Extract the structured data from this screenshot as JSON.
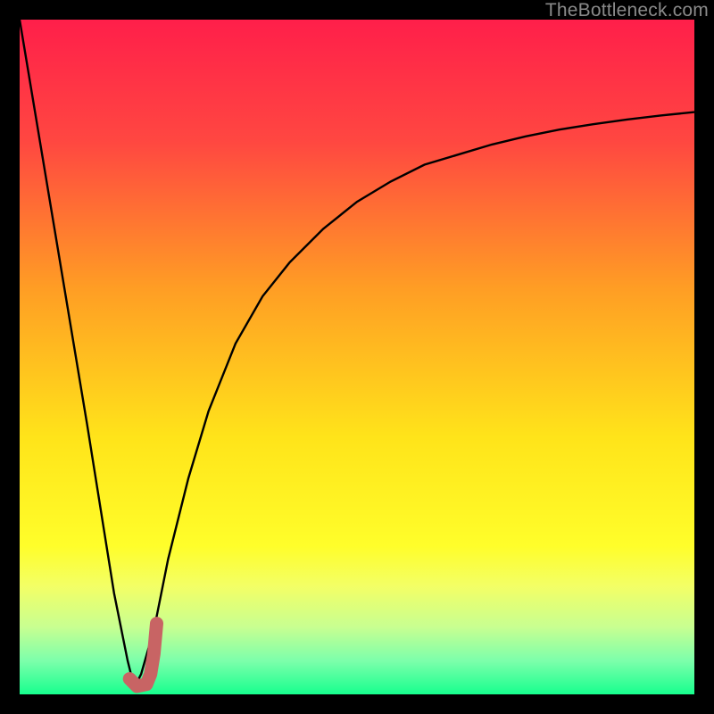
{
  "watermark": "TheBottleneck.com",
  "gradient_stops": [
    {
      "pct": 0,
      "color": "#ff1f4a"
    },
    {
      "pct": 18,
      "color": "#ff4741"
    },
    {
      "pct": 40,
      "color": "#ff9e24"
    },
    {
      "pct": 62,
      "color": "#ffe41a"
    },
    {
      "pct": 78,
      "color": "#fffe2a"
    },
    {
      "pct": 84,
      "color": "#f3ff66"
    },
    {
      "pct": 90,
      "color": "#c8ff91"
    },
    {
      "pct": 95,
      "color": "#7dffab"
    },
    {
      "pct": 100,
      "color": "#17ff8e"
    }
  ],
  "curve": {
    "color": "#000000",
    "width": 2.4
  },
  "marker": {
    "color": "#c86464",
    "width": 15,
    "linecap": "round"
  },
  "chart_data": {
    "type": "line",
    "title": "",
    "xlabel": "",
    "ylabel": "",
    "xlim": [
      0,
      100
    ],
    "ylim": [
      0,
      100
    ],
    "note": "Axes are unlabeled; x and y are normalized 0–100 from pixel positions. y=100 is top (red), y=0 is bottom (green). Curve shows a sharp dip to ~0 near x≈17 then asymptotically rises toward ~86.",
    "series": [
      {
        "name": "bottleneck-curve",
        "x": [
          0,
          5,
          10,
          14,
          16,
          17,
          18,
          20,
          22,
          25,
          28,
          32,
          36,
          40,
          45,
          50,
          55,
          60,
          65,
          70,
          75,
          80,
          85,
          90,
          95,
          100
        ],
        "y": [
          100,
          70,
          40,
          15,
          5,
          1,
          3,
          10,
          20,
          32,
          42,
          52,
          59,
          64,
          69,
          73,
          76,
          78.5,
          80,
          81.5,
          82.7,
          83.7,
          84.5,
          85.2,
          85.8,
          86.3
        ]
      }
    ],
    "marker_path": {
      "name": "highlight-J",
      "x": [
        16.3,
        17.4,
        18.8,
        19.4,
        19.9,
        20.3
      ],
      "y": [
        2.3,
        1.2,
        1.5,
        3.0,
        6.0,
        10.5
      ]
    }
  }
}
